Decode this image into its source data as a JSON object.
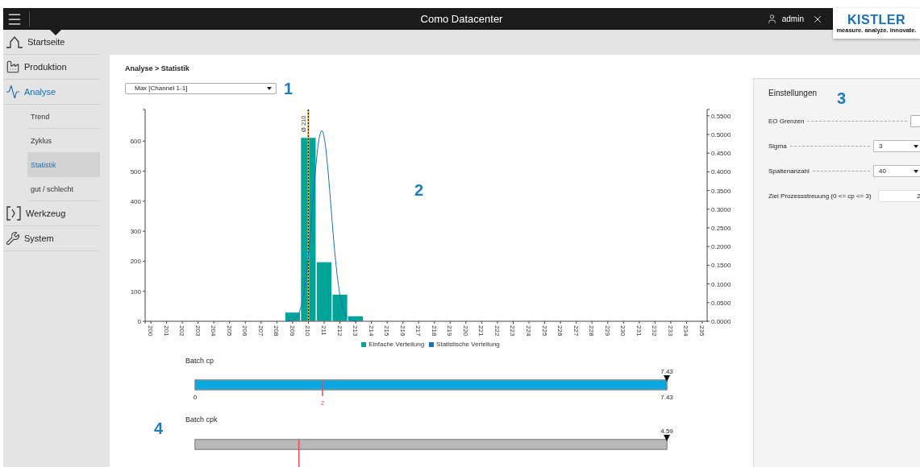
{
  "header": {
    "title": "Como Datacenter",
    "user": "admin"
  },
  "logo": {
    "name": "KISTLER",
    "tagline": "measure. analyze. innovate."
  },
  "sidebar": {
    "items": [
      {
        "label": "Startseite",
        "selected": false
      },
      {
        "label": "Produktion",
        "selected": false
      },
      {
        "label": "Analyse",
        "selected": true,
        "children": [
          {
            "label": "Trend",
            "selected": false
          },
          {
            "label": "Zyklus",
            "selected": false
          },
          {
            "label": "Statistik",
            "selected": true
          },
          {
            "label": "gut / schlecht",
            "selected": false
          }
        ]
      },
      {
        "label": "Werkzeug",
        "selected": false
      },
      {
        "label": "System",
        "selected": false
      }
    ]
  },
  "breadcrumb": "Analyse > Statistik",
  "channel_select": {
    "value": "Max [Channel 1-1]"
  },
  "histogram": {
    "chart_data": {
      "type": "bar",
      "categories": [
        "200",
        "201",
        "202",
        "203",
        "204",
        "205",
        "206",
        "207",
        "208",
        "209",
        "210",
        "211",
        "212",
        "213",
        "214",
        "215",
        "216",
        "217",
        "218",
        "219",
        "220",
        "221",
        "222",
        "223",
        "224",
        "225",
        "226",
        "227",
        "228",
        "229",
        "230",
        "231",
        "232",
        "233",
        "234",
        "235"
      ],
      "series": [
        {
          "name": "Einfache Verteilung",
          "color": "#00a499",
          "values": [
            0,
            0,
            0,
            0,
            0,
            0,
            0,
            0,
            0,
            30,
            612,
            198,
            90,
            18,
            0,
            0,
            0,
            0,
            0,
            0,
            0,
            0,
            0,
            0,
            0,
            0,
            0,
            0,
            0,
            0,
            0,
            0,
            0,
            0,
            0,
            0
          ]
        }
      ],
      "ylim": [
        0,
        700
      ],
      "yticks": [
        0,
        100,
        200,
        300,
        400,
        500,
        600
      ],
      "y2lim": [
        0,
        0.5625
      ],
      "y2ticks": [
        {
          "value": 0,
          "label": "0.0000"
        },
        {
          "value": 0.05,
          "label": "0.0500"
        },
        {
          "value": 0.1,
          "label": "0.1000"
        },
        {
          "value": 0.15,
          "label": "0.1500"
        },
        {
          "value": 0.2,
          "label": "0.2000"
        },
        {
          "value": 0.25,
          "label": "0.2500"
        },
        {
          "value": 0.3,
          "label": "0.3000"
        },
        {
          "value": 0.35,
          "label": "0.3500"
        },
        {
          "value": 0.4,
          "label": "0.4000"
        },
        {
          "value": 0.45,
          "label": "0.4500"
        },
        {
          "value": 0.5,
          "label": "0.5000"
        },
        {
          "value": 0.55,
          "label": "0.5500"
        }
      ],
      "ref_lines": [
        {
          "axis": "x",
          "value": "210",
          "label": "Ø 210"
        }
      ]
    },
    "curve": {
      "name": "Statistische Verteilung",
      "color": "#1c6fb8"
    }
  },
  "gauges": [
    {
      "title": "Batch cp",
      "color": "#0aa8e0",
      "level": 1,
      "value_label": "7.43",
      "min_label": "0",
      "max_label": "7.43",
      "target": {
        "level": 0.27,
        "label": "2"
      }
    },
    {
      "title": "Batch cpk",
      "color": "#b9b9b9",
      "level": 1,
      "value_label": "4.59",
      "target": {
        "level": 0.22
      }
    }
  ],
  "settings": {
    "title": "Einstellungen",
    "rows": [
      {
        "label": "EO Grenzen",
        "kind": "checkbox",
        "checked": false
      },
      {
        "label": "Sigma",
        "kind": "select",
        "value": "3"
      },
      {
        "label": "Spaltenanzahl",
        "kind": "select",
        "value": "40"
      },
      {
        "label": "Ziel Prozessstreuung (0 <= cp <= 3)",
        "kind": "input",
        "value": "2"
      }
    ]
  },
  "callouts": [
    "1",
    "2",
    "3",
    "4"
  ]
}
